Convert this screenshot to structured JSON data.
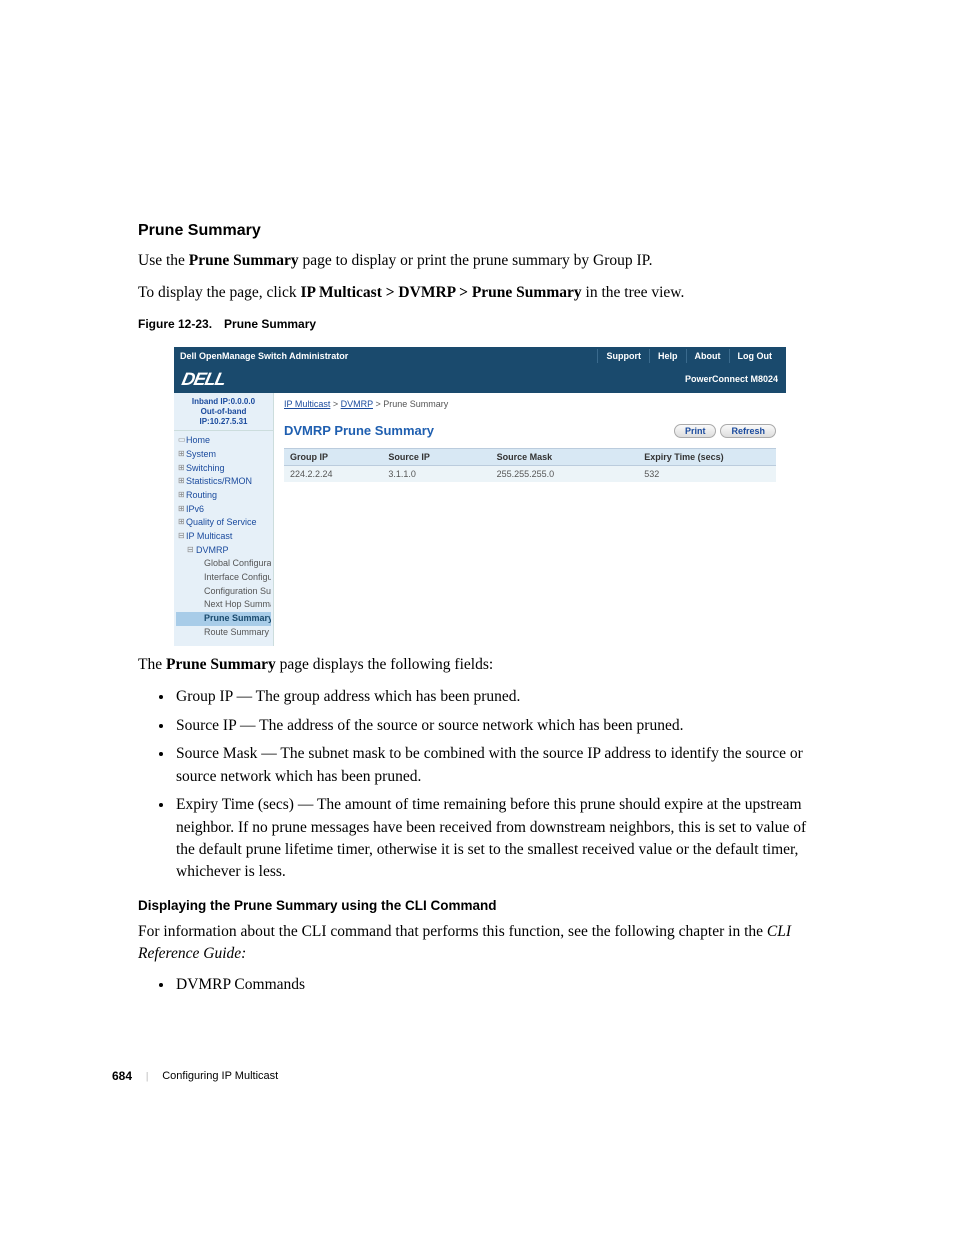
{
  "heading": "Prune Summary",
  "para1_a": "Use the ",
  "para1_b": "Prune Summary",
  "para1_c": " page to display or print the prune summary by Group IP.",
  "para2_a": "To display the page, click ",
  "para2_b": "IP Multicast > DVMRP > Prune Summary",
  "para2_c": " in the tree view.",
  "figcap_a": "Figure 12-23.",
  "figcap_b": "Prune Summary",
  "shot": {
    "title": "Dell OpenManage Switch Administrator",
    "tabs": {
      "support": "Support",
      "help": "Help",
      "about": "About",
      "logout": "Log Out"
    },
    "logo": "DELL",
    "model": "PowerConnect M8024",
    "ip1": "Inband IP:0.0.0.0",
    "ip2": "Out-of-band IP:10.27.5.31",
    "tree": {
      "home": "Home",
      "system": "System",
      "switching": "Switching",
      "stats": "Statistics/RMON",
      "routing": "Routing",
      "ipv6": "IPv6",
      "qos": "Quality of Service",
      "ipm": "IP Multicast",
      "dvmrp": "DVMRP",
      "gc": "Global Configuration",
      "ic": "Interface Configuration",
      "cs": "Configuration Summa",
      "nhs": "Next Hop Summary",
      "ps": "Prune Summary",
      "rs": "Route Summary"
    },
    "crumbs": {
      "a": "IP Multicast",
      "b": "DVMRP",
      "c": "Prune Summary"
    },
    "panel_title": "DVMRP Prune Summary",
    "buttons": {
      "print": "Print",
      "refresh": "Refresh"
    },
    "columns": {
      "c1": "Group IP",
      "c2": "Source IP",
      "c3": "Source Mask",
      "c4": "Expiry Time (secs)"
    },
    "row": {
      "c1": "224.2.2.24",
      "c2": "3.1.1.0",
      "c3": "255.255.255.0",
      "c4": "532"
    }
  },
  "after_intro_a": "The ",
  "after_intro_b": "Prune Summary",
  "after_intro_c": " page displays the following fields:",
  "fields": {
    "f1_t": "Group IP",
    "f1_d": " — The group address which has been pruned.",
    "f2_t": "Source IP",
    "f2_d": " — The address of the source or source network which has been pruned.",
    "f3_t": "Source Mask",
    "f3_d": " — The subnet mask to be combined with the source IP address to identify the source or source network which has been pruned.",
    "f4_t": "Expiry Time (secs)",
    "f4_d": " — The amount of time remaining before this prune should expire at the upstream neighbor. If no prune messages have been received from downstream neighbors, this is set to value of the default prune lifetime timer, otherwise it is set to the smallest received value or the default timer, whichever is less."
  },
  "cli_heading": "Displaying the Prune Summary using the CLI Command",
  "cli_para_a": "For information about the CLI command that performs this function, see the following chapter in the ",
  "cli_para_b": "CLI Reference Guide:",
  "cli_bullet": "DVMRP Commands",
  "footer": {
    "page": "684",
    "chapter": "Configuring IP Multicast"
  }
}
